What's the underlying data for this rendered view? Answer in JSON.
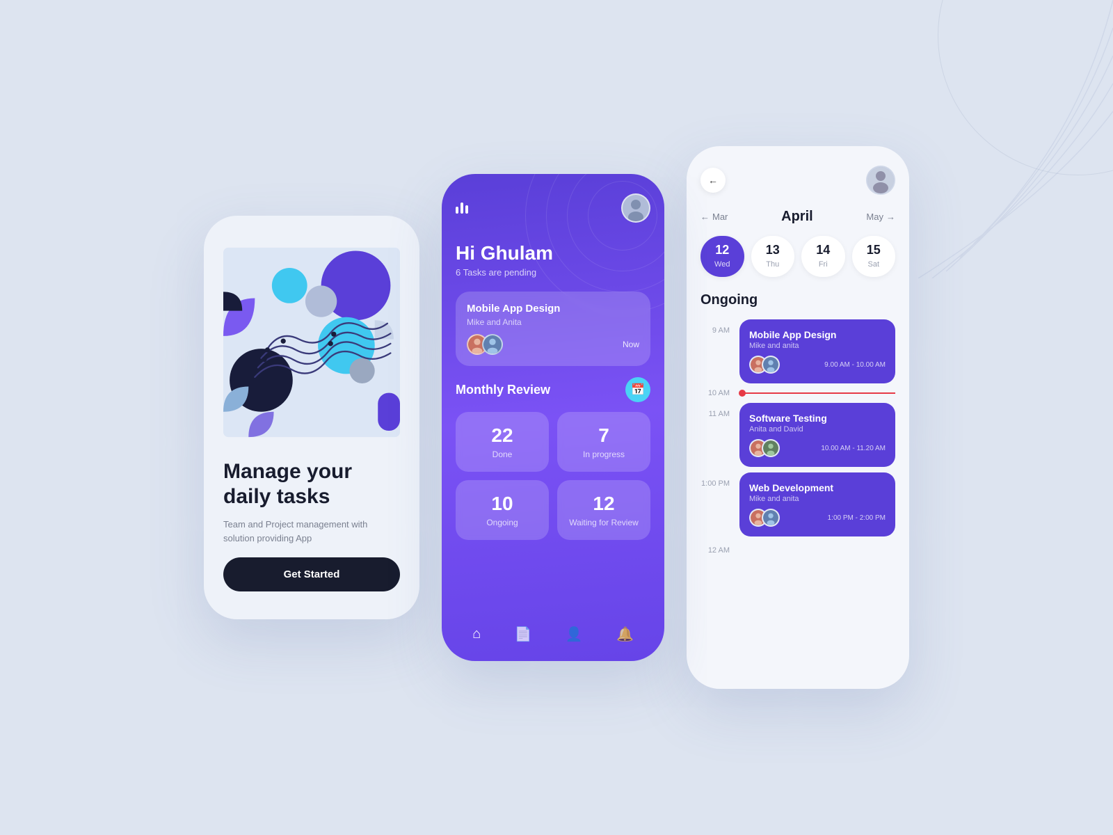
{
  "phone1": {
    "headline_line1": "Manage your",
    "headline_line2": "daily tasks",
    "subtitle": "Team and Project management with solution providing App",
    "cta": "Get Started"
  },
  "phone2": {
    "greeting": "Hi Ghulam",
    "tasks_pending": "6 Tasks are pending",
    "task1_title": "Mobile App Design",
    "task1_sub": "Mike and Anita",
    "task1_badge": "Now",
    "monthly_review": "Monthly Review",
    "stat1_num": "22",
    "stat1_lbl": "Done",
    "stat2_num": "7",
    "stat2_lbl": "In progress",
    "stat3_num": "10",
    "stat3_lbl": "Ongoing",
    "stat4_num": "12",
    "stat4_lbl": "Waiting for Review"
  },
  "phone3": {
    "month": "April",
    "prev_month": "Mar",
    "next_month": "May",
    "dates": [
      {
        "num": "12",
        "day": "Wed",
        "active": true
      },
      {
        "num": "13",
        "day": "Thu",
        "active": false
      },
      {
        "num": "14",
        "day": "Fri",
        "active": false
      },
      {
        "num": "15",
        "day": "Sat",
        "active": false
      }
    ],
    "ongoing_label": "Ongoing",
    "time1": "9 AM",
    "event1_title": "Mobile App Design",
    "event1_sub": "Mike and anita",
    "event1_time": "9.00 AM - 10.00 AM",
    "current_time": "10 AM",
    "time2": "11 AM",
    "event2_title": "Software Testing",
    "event2_sub": "Anita and David",
    "event2_time": "10.00 AM - 11.20 AM",
    "time3": "12 AM",
    "event3_title": "Web Development",
    "event3_sub": "Mike and anita",
    "event3_time": "1:00 PM - 2:00 PM",
    "time3_label": "1:00 PM",
    "time4_label": "12 AM"
  }
}
